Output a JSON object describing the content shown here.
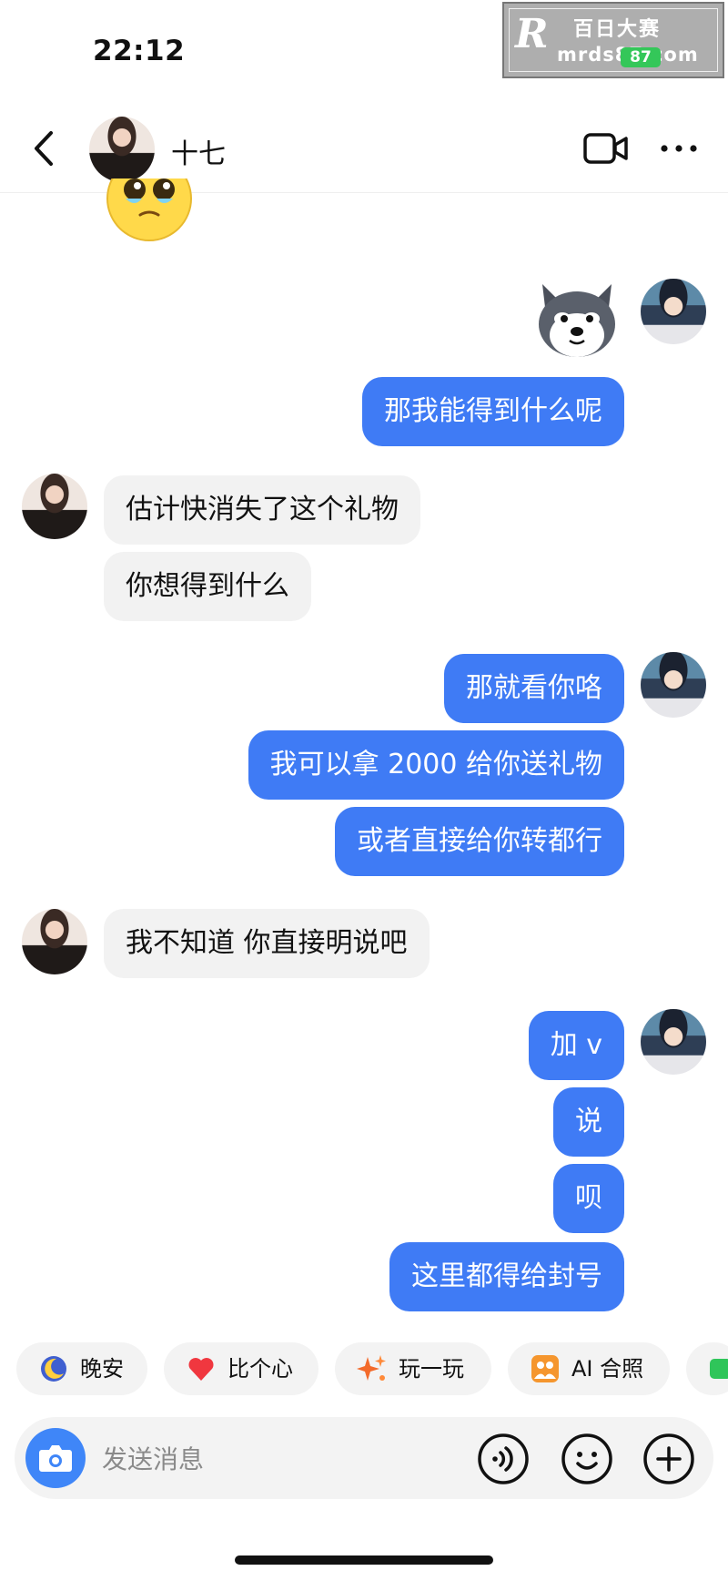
{
  "status_bar": {
    "time": "22:12"
  },
  "watermark": {
    "title": "百日大赛",
    "url": "mrds87.com",
    "battery": "87"
  },
  "header": {
    "contact_name": "十七"
  },
  "messages": [
    {
      "from": "me",
      "text": "那我能得到什么呢"
    },
    {
      "from": "them",
      "text": "估计快消失了这个礼物"
    },
    {
      "from": "them",
      "text": "你想得到什么"
    },
    {
      "from": "me",
      "text": "那就看你咯"
    },
    {
      "from": "me",
      "text": "我可以拿 2000 给你送礼物"
    },
    {
      "from": "me",
      "text": "或者直接给你转都行"
    },
    {
      "from": "them",
      "text": "我不知道 你直接明说吧"
    },
    {
      "from": "me",
      "text": "加 v"
    },
    {
      "from": "me",
      "text": "说"
    },
    {
      "from": "me",
      "text": "呗"
    },
    {
      "from": "me",
      "text": "这里都得给封号"
    }
  ],
  "quick_replies": [
    {
      "label": "晚安",
      "icon": "moon-icon"
    },
    {
      "label": "比个心",
      "icon": "heart-icon"
    },
    {
      "label": "玩一玩",
      "icon": "sparkle-icon"
    },
    {
      "label": "AI 合照",
      "icon": "photo-icon"
    }
  ],
  "input": {
    "placeholder": "发送消息"
  },
  "colors": {
    "outgoing_bubble": "#3f7bf5",
    "incoming_bubble": "#f2f2f2",
    "camera_button": "#3f86f8"
  }
}
